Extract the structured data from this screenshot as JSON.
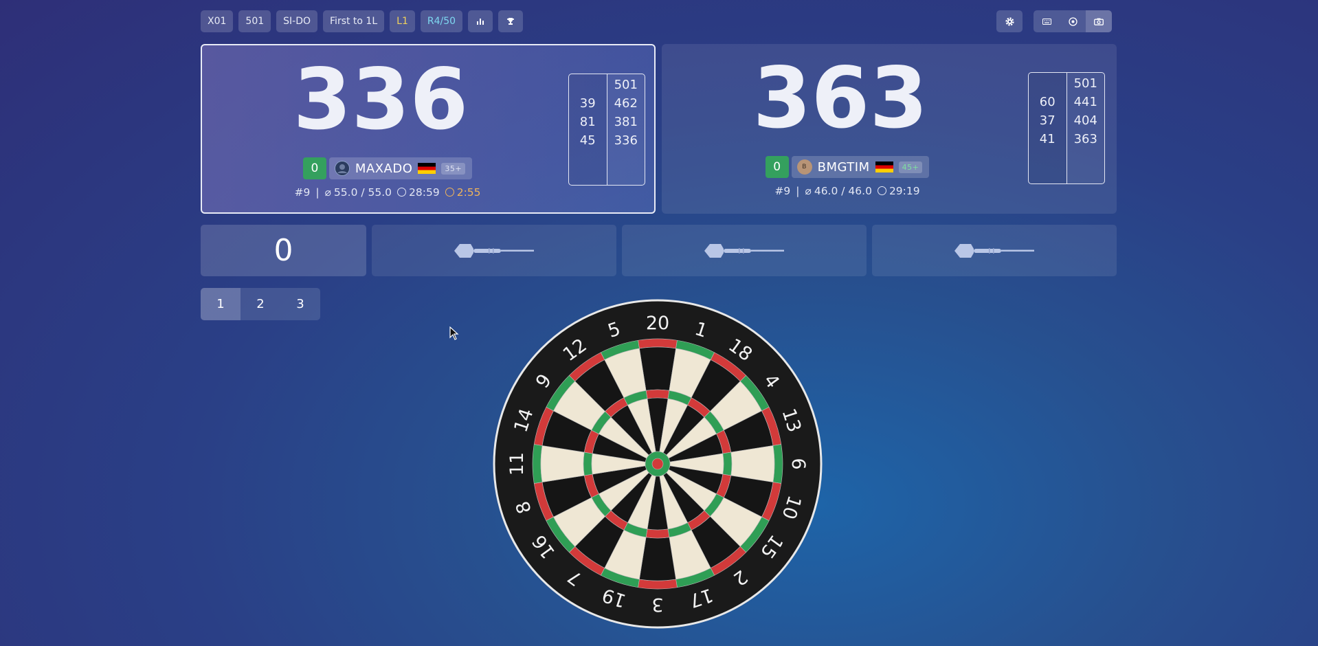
{
  "topbar": {
    "chips": [
      "X01",
      "501",
      "SI-DO",
      "First to 1L",
      "L1",
      "R4/50"
    ],
    "stats_icon": "bar-chart-icon",
    "trophy_icon": "trophy-icon",
    "settings_icon": "gear-icon",
    "view_icons": [
      "keyboard-icon",
      "target-icon",
      "camera-icon"
    ]
  },
  "players": [
    {
      "score": "336",
      "legs": "0",
      "name": "MAXADO",
      "level": "35+",
      "stat_rank": "#9",
      "stat_avg": "55.0 / 55.0",
      "stat_time": "28:59",
      "stat_turn_time": "2:55",
      "thrown": [
        "39",
        "81",
        "45"
      ],
      "remaining": [
        "501",
        "462",
        "381",
        "336"
      ],
      "active": true
    },
    {
      "score": "363",
      "legs": "0",
      "name": "BMGTIM",
      "avatar_letter": "B",
      "level": "45+",
      "stat_rank": "#9",
      "stat_avg": "46.0 / 46.0",
      "stat_time": "29:19",
      "thrown": [
        "60",
        "37",
        "41"
      ],
      "remaining": [
        "501",
        "441",
        "404",
        "363"
      ],
      "active": false
    }
  ],
  "turn": {
    "current_total": "0",
    "dart_icons": [
      "dart-icon",
      "dart-icon",
      "dart-icon"
    ]
  },
  "pager": [
    "1",
    "2",
    "3"
  ],
  "dartboard": {
    "numbers": [
      "20",
      "1",
      "18",
      "4",
      "13",
      "6",
      "10",
      "15",
      "2",
      "17",
      "3",
      "19",
      "7",
      "16",
      "8",
      "11",
      "14",
      "9",
      "12",
      "5"
    ],
    "colors": {
      "red": "#d23a3a",
      "green": "#2f9e55",
      "black": "#151515",
      "cream": "#efe7d4"
    }
  }
}
